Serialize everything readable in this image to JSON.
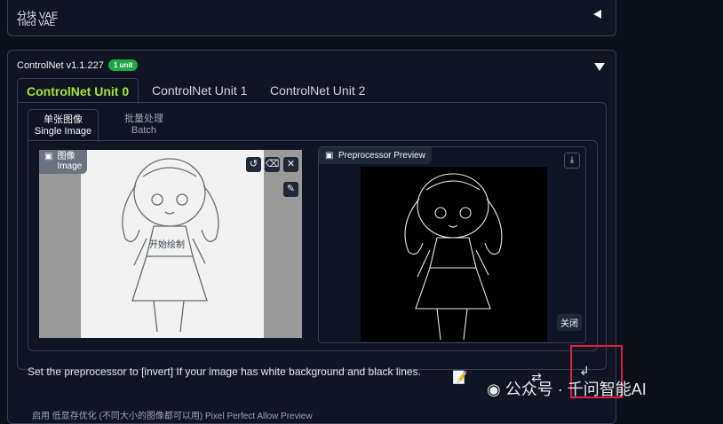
{
  "tiled_vae": {
    "title_cn": "分块 VAE",
    "title_en": "Tiled VAE"
  },
  "controlnet": {
    "title": "ControlNet v1.1.227",
    "badge": "1 unit",
    "tabs": [
      "ControlNet Unit 0",
      "ControlNet Unit 1",
      "ControlNet Unit 2"
    ],
    "subtabs": [
      {
        "cn": "单张图像",
        "en": "Single Image"
      },
      {
        "cn": "批量处理",
        "en": "Batch"
      }
    ],
    "image_panel": {
      "label_cn": "图像",
      "label_en": "Image",
      "overlay_text": "开始绘制"
    },
    "preview_panel": {
      "label": "Preprocessor Preview",
      "close_label": "关闭"
    },
    "hint": "Set the preprocessor to [invert] If your image has white background and black lines."
  },
  "watermark": {
    "text": "公众号 · 千问智能AI"
  },
  "bottom_text": "启用       低显存优化 (不同大小的图像都可以用)       Pixel Perfect       Allow Preview",
  "colors": {
    "accent": "#a3e635",
    "badge": "#22a546",
    "highlight": "#e11d48"
  }
}
